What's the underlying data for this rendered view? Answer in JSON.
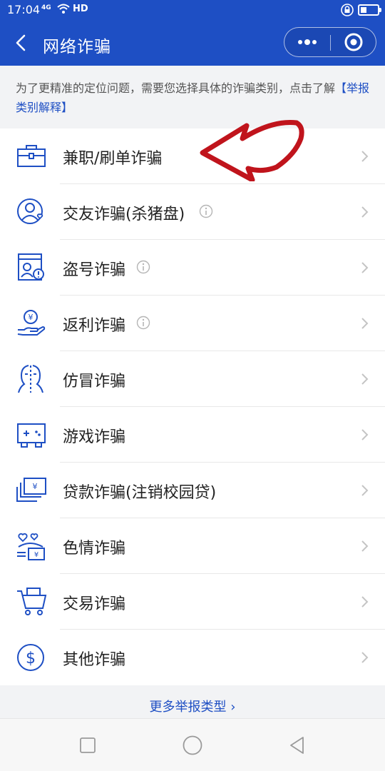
{
  "status": {
    "time": "17:04",
    "net": "4G",
    "hd": "HD"
  },
  "nav": {
    "title": "网络诈骗"
  },
  "notice": {
    "text": "为了更精准的定位问题，需要您选择具体的诈骗类别，点击了解",
    "link": "【举报类别解释】"
  },
  "categories": [
    {
      "label": "兼职/刷单诈骗",
      "icon": "briefcase-icon",
      "info": false
    },
    {
      "label": "交友诈骗(杀猪盘)",
      "icon": "user-heart-icon",
      "info": true
    },
    {
      "label": "盗号诈骗",
      "icon": "id-card-warning-icon",
      "info": true
    },
    {
      "label": "返利诈骗",
      "icon": "coin-hand-icon",
      "info": true
    },
    {
      "label": "仿冒诈骗",
      "icon": "face-split-icon",
      "info": false
    },
    {
      "label": "游戏诈骗",
      "icon": "gamepad-icon",
      "info": false
    },
    {
      "label": "贷款诈骗(注销校园贷)",
      "icon": "money-cards-icon",
      "info": false
    },
    {
      "label": "色情诈骗",
      "icon": "hearts-money-icon",
      "info": false
    },
    {
      "label": "交易诈骗",
      "icon": "shopping-cart-icon",
      "info": false
    },
    {
      "label": "其他诈骗",
      "icon": "dollar-circle-icon",
      "info": false
    }
  ],
  "footer": {
    "more_label": "更多举报类型 ›"
  },
  "colors": {
    "brand": "#1e4fc4",
    "annotation": "#c0141c"
  }
}
